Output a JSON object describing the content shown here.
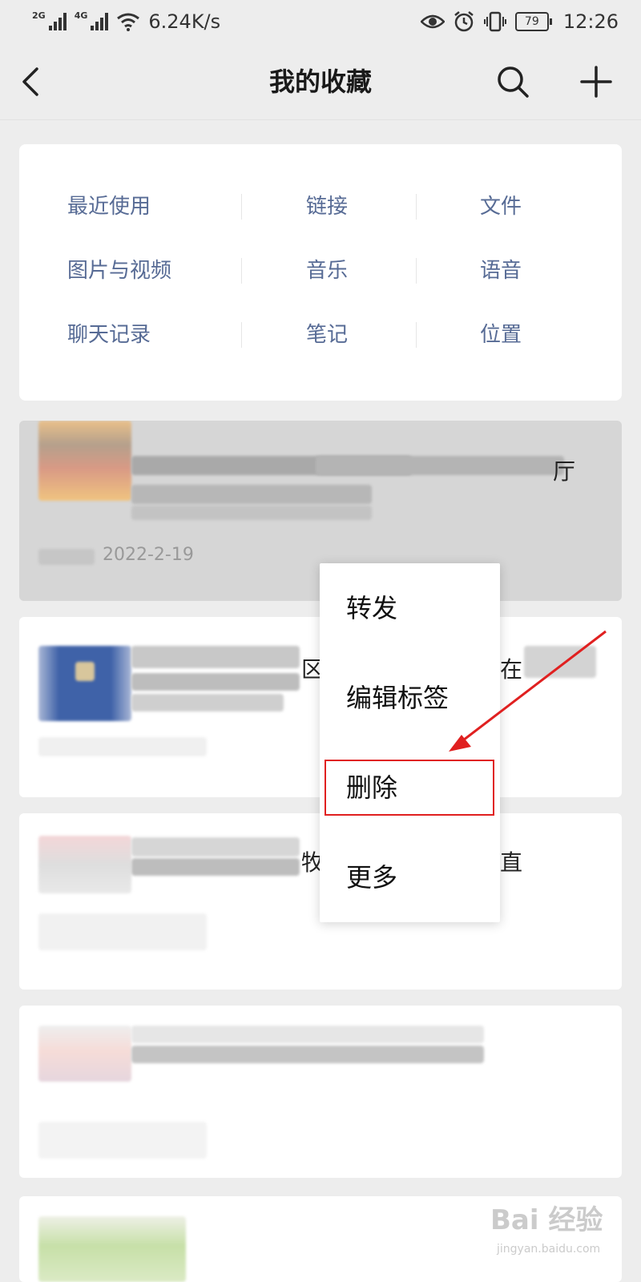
{
  "status_bar": {
    "net1": "2G",
    "net2": "4G",
    "speed": "6.24K/s",
    "battery": "79",
    "time": "12:26"
  },
  "nav": {
    "title": "我的收藏",
    "icons": [
      "back-icon",
      "search-icon",
      "add-icon"
    ]
  },
  "categories": [
    [
      "最近使用",
      "链接",
      "文件"
    ],
    [
      "图片与视频",
      "音乐",
      "语音"
    ],
    [
      "聊天记录",
      "笔记",
      "位置"
    ]
  ],
  "items": [
    {
      "visible_text": "厅",
      "date": "2022-2-19"
    },
    {
      "visible_text_1": "区",
      "visible_text_2": "在"
    },
    {
      "visible_text_1": "牧",
      "visible_text_2": "直"
    }
  ],
  "context_menu": {
    "items": [
      "转发",
      "编辑标签",
      "删除",
      "更多"
    ],
    "highlighted_index": 2
  },
  "watermark": {
    "text": "Bai 经验",
    "sub": "jingyan.baidu.com"
  },
  "colors": {
    "link_blue": "#576b95",
    "highlight_red": "#e02020",
    "page_bg": "#ededed"
  }
}
